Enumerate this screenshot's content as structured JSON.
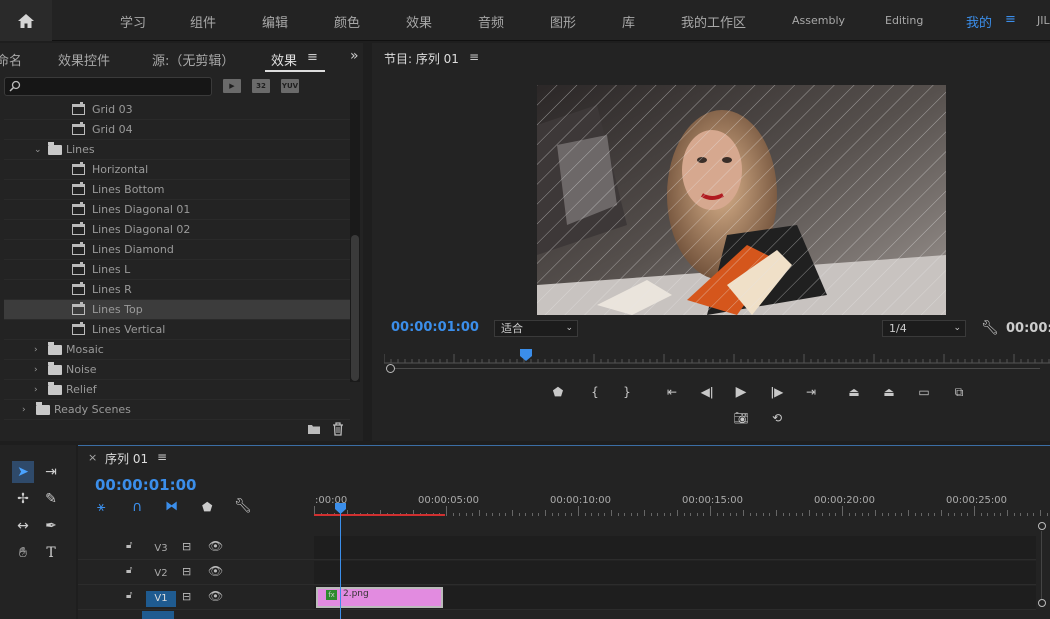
{
  "topbar": {
    "workspaces": [
      "学习",
      "组件",
      "编辑",
      "颜色",
      "效果",
      "音频",
      "图形",
      "库",
      "我的工作区",
      "Assembly",
      "Editing",
      "我的",
      "JIL"
    ]
  },
  "left_panel": {
    "tabs": [
      "命名",
      "效果控件",
      "源:（无剪辑）",
      "效果"
    ],
    "menu_icon": "≡",
    "expand_icon": "»",
    "search_placeholder": "",
    "filter_buttons": [
      "32",
      "YUV"
    ],
    "tree": [
      {
        "label": "Grid 03",
        "type": "effect",
        "indent": 2
      },
      {
        "label": "Grid 04",
        "type": "effect",
        "indent": 2
      },
      {
        "label": "Lines",
        "type": "folder",
        "indent": 1,
        "expanded": true
      },
      {
        "label": "Horizontal",
        "type": "effect",
        "indent": 2
      },
      {
        "label": "Lines Bottom",
        "type": "effect",
        "indent": 2
      },
      {
        "label": "Lines Diagonal 01",
        "type": "effect",
        "indent": 2
      },
      {
        "label": "Lines Diagonal 02",
        "type": "effect",
        "indent": 2
      },
      {
        "label": "Lines Diamond",
        "type": "effect",
        "indent": 2
      },
      {
        "label": "Lines L",
        "type": "effect",
        "indent": 2
      },
      {
        "label": "Lines R",
        "type": "effect",
        "indent": 2
      },
      {
        "label": "Lines Top",
        "type": "effect",
        "indent": 2,
        "selected": true
      },
      {
        "label": "Lines Vertical",
        "type": "effect",
        "indent": 2
      },
      {
        "label": "Mosaic",
        "type": "folder",
        "indent": 1,
        "expanded": false
      },
      {
        "label": "Noise",
        "type": "folder",
        "indent": 1,
        "expanded": false
      },
      {
        "label": "Relief",
        "type": "folder",
        "indent": 1,
        "expanded": false
      },
      {
        "label": "Ready Scenes",
        "type": "folder",
        "indent": 0,
        "expanded": false
      }
    ]
  },
  "program_monitor": {
    "title": "节目: 序列 01",
    "timecode": "00:00:01:00",
    "fit_label": "适合",
    "resolution": "1/4",
    "end_timecode": "00:00:0"
  },
  "timeline": {
    "sequence_name": "序列 01",
    "timecode": "00:00:01:00",
    "ruler_ticks": [
      ":00:00",
      "00:00:05:00",
      "00:00:10:00",
      "00:00:15:00",
      "00:00:20:00",
      "00:00:25:00"
    ],
    "tracks": [
      {
        "name": "V3",
        "active": false
      },
      {
        "name": "V2",
        "active": false
      },
      {
        "name": "V1",
        "active": true
      }
    ],
    "clip": {
      "label": "2.png",
      "badge": "fx",
      "color": "#e28be0"
    }
  },
  "colors": {
    "accent": "#3b8eea",
    "playhead": "#3b8eea",
    "in_out_bar": "#d03030",
    "clip": "#e28be0"
  }
}
